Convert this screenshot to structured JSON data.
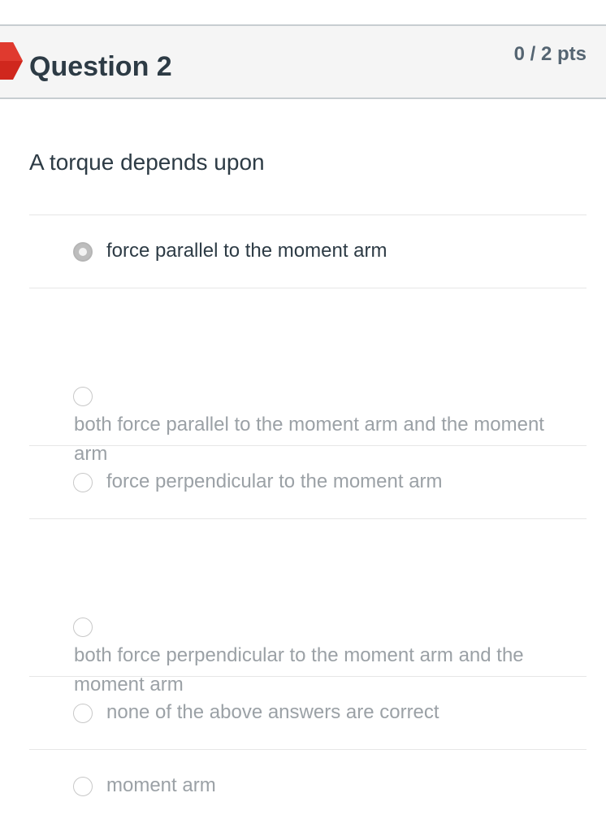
{
  "question": {
    "title": "Question 2",
    "points": "0 / 2 pts",
    "text": "A torque depends upon"
  },
  "answers": [
    {
      "label": "force parallel to the moment arm",
      "selected": true
    },
    {
      "label": "both force parallel to the moment arm and the moment arm",
      "selected": false
    },
    {
      "label": "force perpendicular to the moment arm",
      "selected": false
    },
    {
      "label": "both force perpendicular to the moment arm and the moment arm",
      "selected": false
    },
    {
      "label": "none of the above answers are correct",
      "selected": false
    },
    {
      "label": "moment arm",
      "selected": false
    }
  ],
  "colors": {
    "flag": "#d0271d",
    "title_text": "#2d3b45",
    "muted_text": "#9ba1a6",
    "header_bg": "#f5f5f5"
  },
  "icons": {
    "flag": "incorrect-flag-icon",
    "radio": "radio-button-icon"
  }
}
